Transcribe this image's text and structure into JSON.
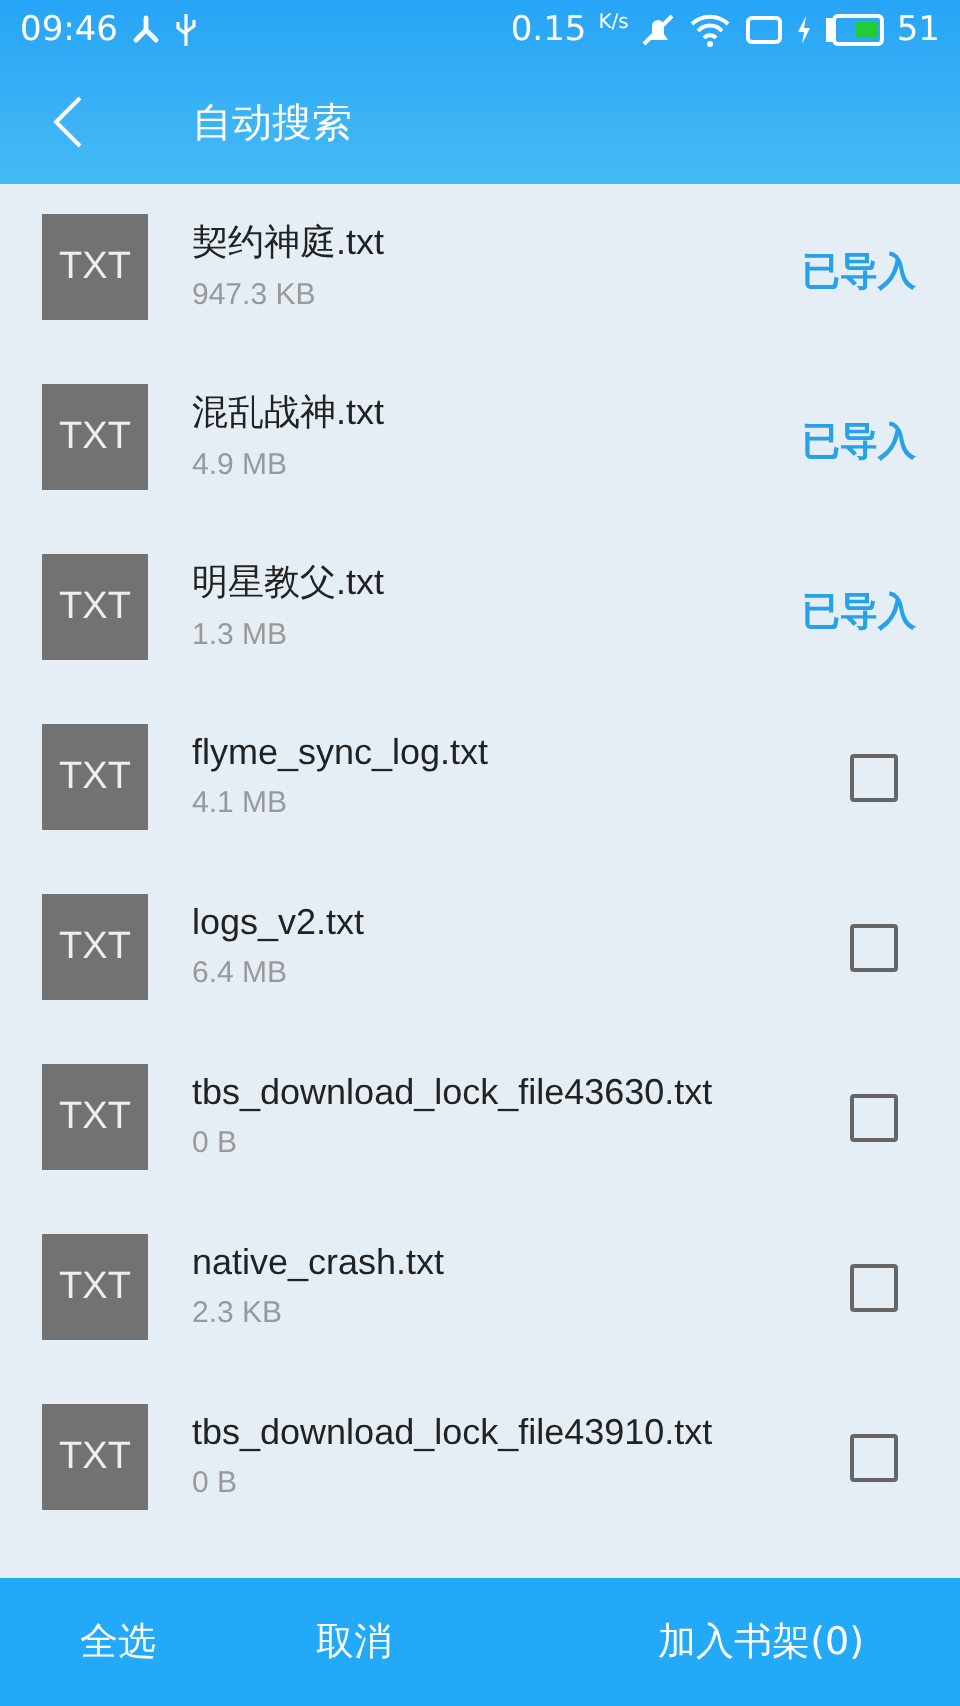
{
  "status_bar": {
    "time": "09:46",
    "speed": "0.15",
    "speed_unit": "K/s",
    "battery": "51"
  },
  "header": {
    "title": "自动搜索"
  },
  "files": [
    {
      "icon_text": "TXT",
      "name": "契约神庭.txt",
      "size": "947.3 KB",
      "kind": "imported",
      "status": "已导入"
    },
    {
      "icon_text": "TXT",
      "name": "混乱战神.txt",
      "size": "4.9 MB",
      "kind": "imported",
      "status": "已导入"
    },
    {
      "icon_text": "TXT",
      "name": "明星教父.txt",
      "size": "1.3 MB",
      "kind": "imported",
      "status": "已导入"
    },
    {
      "icon_text": "TXT",
      "name": "flyme_sync_log.txt",
      "size": "4.1 MB",
      "kind": "checkbox",
      "checked": false
    },
    {
      "icon_text": "TXT",
      "name": "logs_v2.txt",
      "size": "6.4 MB",
      "kind": "checkbox",
      "checked": false
    },
    {
      "icon_text": "TXT",
      "name": "tbs_download_lock_file43630.txt",
      "size": "0 B",
      "kind": "checkbox",
      "checked": false
    },
    {
      "icon_text": "TXT",
      "name": "native_crash.txt",
      "size": "2.3 KB",
      "kind": "checkbox",
      "checked": false
    },
    {
      "icon_text": "TXT",
      "name": "tbs_download_lock_file43910.txt",
      "size": "0 B",
      "kind": "checkbox",
      "checked": false
    }
  ],
  "bottom_bar": {
    "buttons": [
      "全选",
      "取消",
      "加入书架(0)"
    ]
  }
}
